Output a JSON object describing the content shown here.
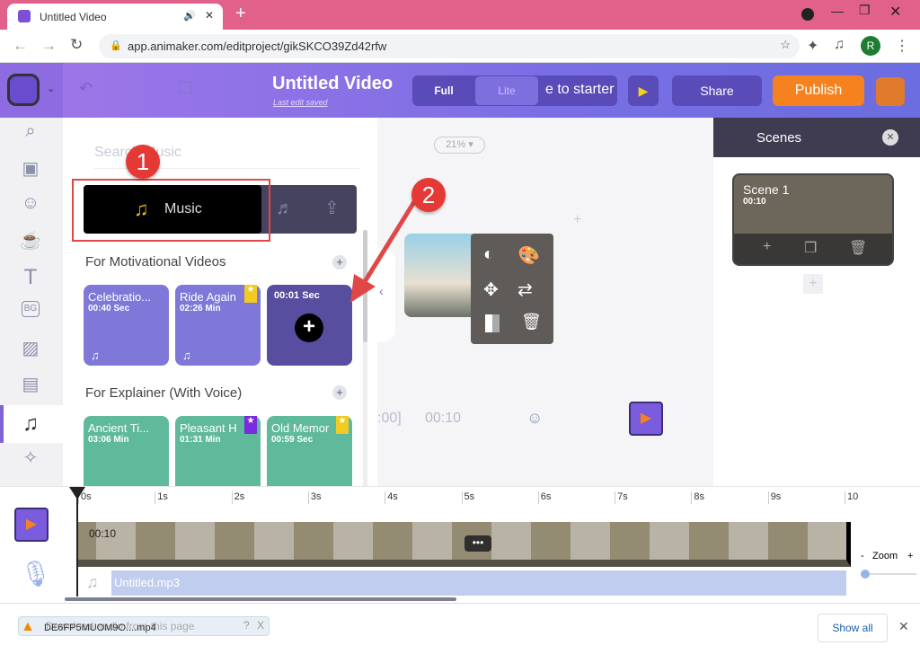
{
  "browser": {
    "tab_title": "Untitled Video",
    "url": "app.animaker.com/editproject/gikSKCO39Zd42rfw",
    "profile_initial": "R"
  },
  "header": {
    "title": "Untitled Video",
    "subtitle": "Last edit saved",
    "toggle_full": "Full",
    "toggle_lite": "Lite",
    "starter_label": "e to starter",
    "share": "Share",
    "publish": "Publish"
  },
  "panel": {
    "search_placeholder": "Search Music",
    "music_tab": "Music",
    "sections": [
      {
        "title": "For Motivational Videos",
        "cards": [
          {
            "name": "Celebratio...",
            "duration": "00:40 Sec"
          },
          {
            "name": "Ride Again",
            "duration": "02:26 Min"
          },
          {
            "name": "",
            "duration": "00:01 Sec"
          }
        ]
      },
      {
        "title": "For Explainer (With Voice)",
        "cards": [
          {
            "name": "Ancient Ti...",
            "duration": "03:06 Min"
          },
          {
            "name": "Pleasant H",
            "duration": "01:31 Min"
          },
          {
            "name": "Old Memor",
            "duration": "00:59 Sec"
          }
        ]
      }
    ]
  },
  "canvas": {
    "zoom": "21%",
    "time_left": ":00]",
    "time_right": "00:10"
  },
  "scenes": {
    "title": "Scenes",
    "scene_name": "Scene 1",
    "scene_duration": "00:10"
  },
  "timeline": {
    "ticks": [
      "0s",
      "1s",
      "2s",
      "3s",
      "4s",
      "5s",
      "6s",
      "7s",
      "8s",
      "9s",
      "10"
    ],
    "track_time": "00:10",
    "audio_file": "Untitled.mp3",
    "zoom_label": "Zoom",
    "zoom_minus": "-",
    "zoom_plus": "+"
  },
  "downloads": {
    "overlay_text": "Download audio from this page",
    "file": "DE6FP5MUOM9O....mp4",
    "show_all": "Show all"
  },
  "annotations": {
    "badge1": "1",
    "badge2": "2"
  },
  "colors": {
    "purple_card": "#7f78d8",
    "green_card": "#5fba9b",
    "publish": "#f5821f",
    "accent": "#6d5fd0"
  }
}
